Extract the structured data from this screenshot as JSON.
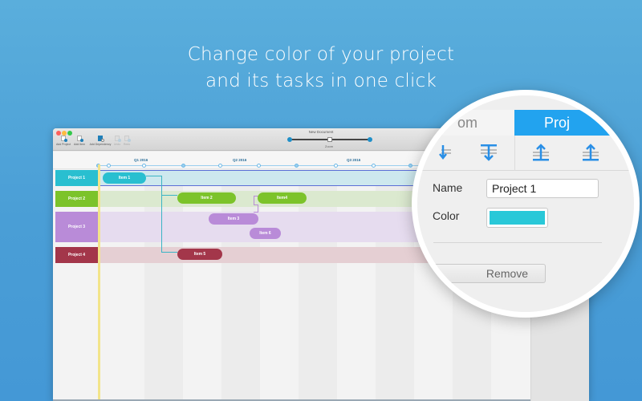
{
  "headline": {
    "line1": "Change color of your project",
    "line2": "and its tasks in one click"
  },
  "window": {
    "title": "New Document",
    "toolbar": [
      {
        "label": "Add Project",
        "icon": "add-project-icon",
        "enabled": true
      },
      {
        "label": "Add Item",
        "icon": "add-item-icon",
        "enabled": true
      },
      {
        "label": "Add Dependency",
        "icon": "add-dependency-icon",
        "enabled": true
      },
      {
        "label": "Undo",
        "icon": "undo-icon",
        "enabled": false
      },
      {
        "label": "Redo",
        "icon": "redo-icon",
        "enabled": false
      }
    ],
    "zoom_label": "Zoom",
    "zoom_level": 0.5
  },
  "timeline": {
    "quarters": [
      "Q1 2016",
      "Q2 2016",
      "Q3 2016"
    ]
  },
  "projects": [
    {
      "name": "Project 1",
      "color": "#29bfd0",
      "band": "#cde8ee"
    },
    {
      "name": "Project 2",
      "color": "#7cc32a",
      "band": "#dbe9cf"
    },
    {
      "name": "Project 3",
      "color": "#b98bd8",
      "band": "#e6dcef"
    },
    {
      "name": "Project 4",
      "color": "#a3364a",
      "band": "#e5cfd3"
    }
  ],
  "tasks": [
    {
      "name": "Item 1",
      "project": 0
    },
    {
      "name": "Item 2",
      "project": 1
    },
    {
      "name": "Item4",
      "project": 1
    },
    {
      "name": "Item 3",
      "project": 2
    },
    {
      "name": "Item 6",
      "project": 2
    },
    {
      "name": "Item 5",
      "project": 3
    }
  ],
  "inspector": {
    "tabs": [
      {
        "label": "Custom",
        "visible_text": "om",
        "active": false
      },
      {
        "label": "Project",
        "visible_text": "Proj",
        "active": true
      }
    ],
    "name_label": "Name",
    "name_value": "Project 1",
    "color_label": "Color",
    "color_value": "#29c8d8",
    "remove_label": "Remove",
    "accent": "#22a3ef"
  }
}
